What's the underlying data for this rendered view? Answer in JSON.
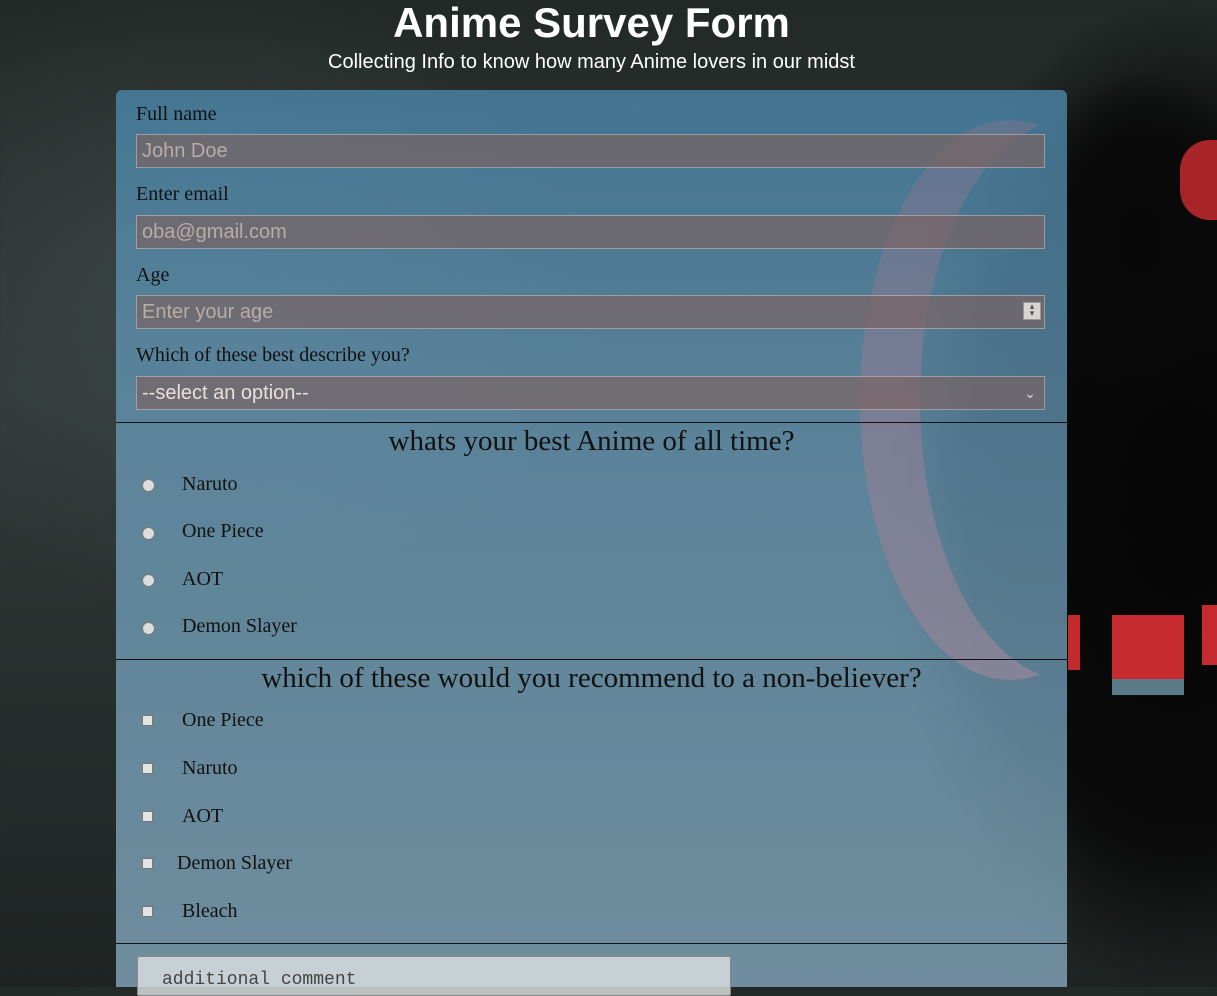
{
  "header": {
    "title": "Anime Survey Form",
    "subtitle": "Collecting Info to know how many Anime lovers in our midst"
  },
  "fields": {
    "name_label": "Full name",
    "name_placeholder": "John Doe",
    "email_label": "Enter email",
    "email_placeholder": "oba@gmail.com",
    "age_label": "Age",
    "age_placeholder": "Enter your age",
    "describe_label": "Which of these best describe you?",
    "describe_selected": "--select an option--"
  },
  "best_anime": {
    "title": "whats your best Anime of all time?",
    "options": [
      "Naruto",
      "One Piece",
      "AOT",
      "Demon Slayer"
    ]
  },
  "recommend": {
    "title": "which of these would you recommend to a non-believer?",
    "options": [
      "One Piece",
      "Naruto",
      "AOT",
      "Demon Slayer",
      "Bleach"
    ]
  },
  "comment": {
    "placeholder": "additional comment"
  },
  "colors": {
    "form_tint": "#78aac8",
    "field_bg": "#786464",
    "moon_red": "#c82828"
  }
}
